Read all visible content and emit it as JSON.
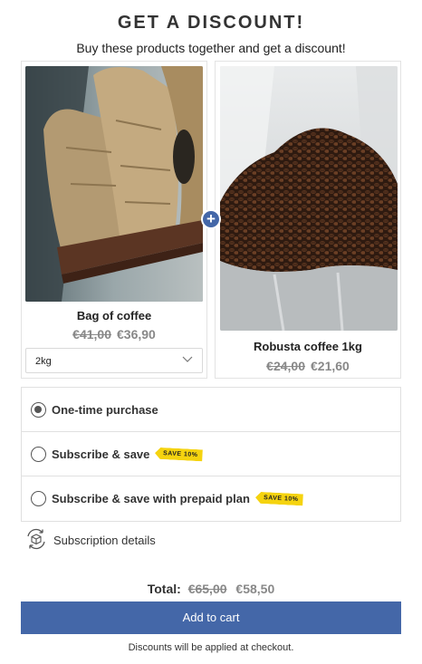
{
  "header": {
    "title": "GET A DISCOUNT!",
    "subtitle": "Buy these products together and get a discount!"
  },
  "products": [
    {
      "name": "Bag of coffee",
      "old_price": "€41,00",
      "new_price": "€36,90",
      "variant": "2kg",
      "image": "burlap-coffee-sacks-on-shelf"
    },
    {
      "name": "Robusta coffee 1kg",
      "old_price": "€24,00",
      "new_price": "€21,60",
      "image": "coffee-beans-in-bag"
    }
  ],
  "purchase_options": [
    {
      "label": "One-time purchase",
      "selected": true
    },
    {
      "label": "Subscribe & save",
      "badge": "SAVE 10%",
      "selected": false
    },
    {
      "label": "Subscribe & save with prepaid plan",
      "badge": "SAVE 10%",
      "selected": false
    }
  ],
  "subscription_details": "Subscription details",
  "total": {
    "label": "Total:",
    "old": "€65,00",
    "new": "€58,50"
  },
  "cart_button": "Add to cart",
  "note": "Discounts will be applied at checkout.",
  "colors": {
    "accent": "#4467a8",
    "badge": "#f5d30f"
  }
}
